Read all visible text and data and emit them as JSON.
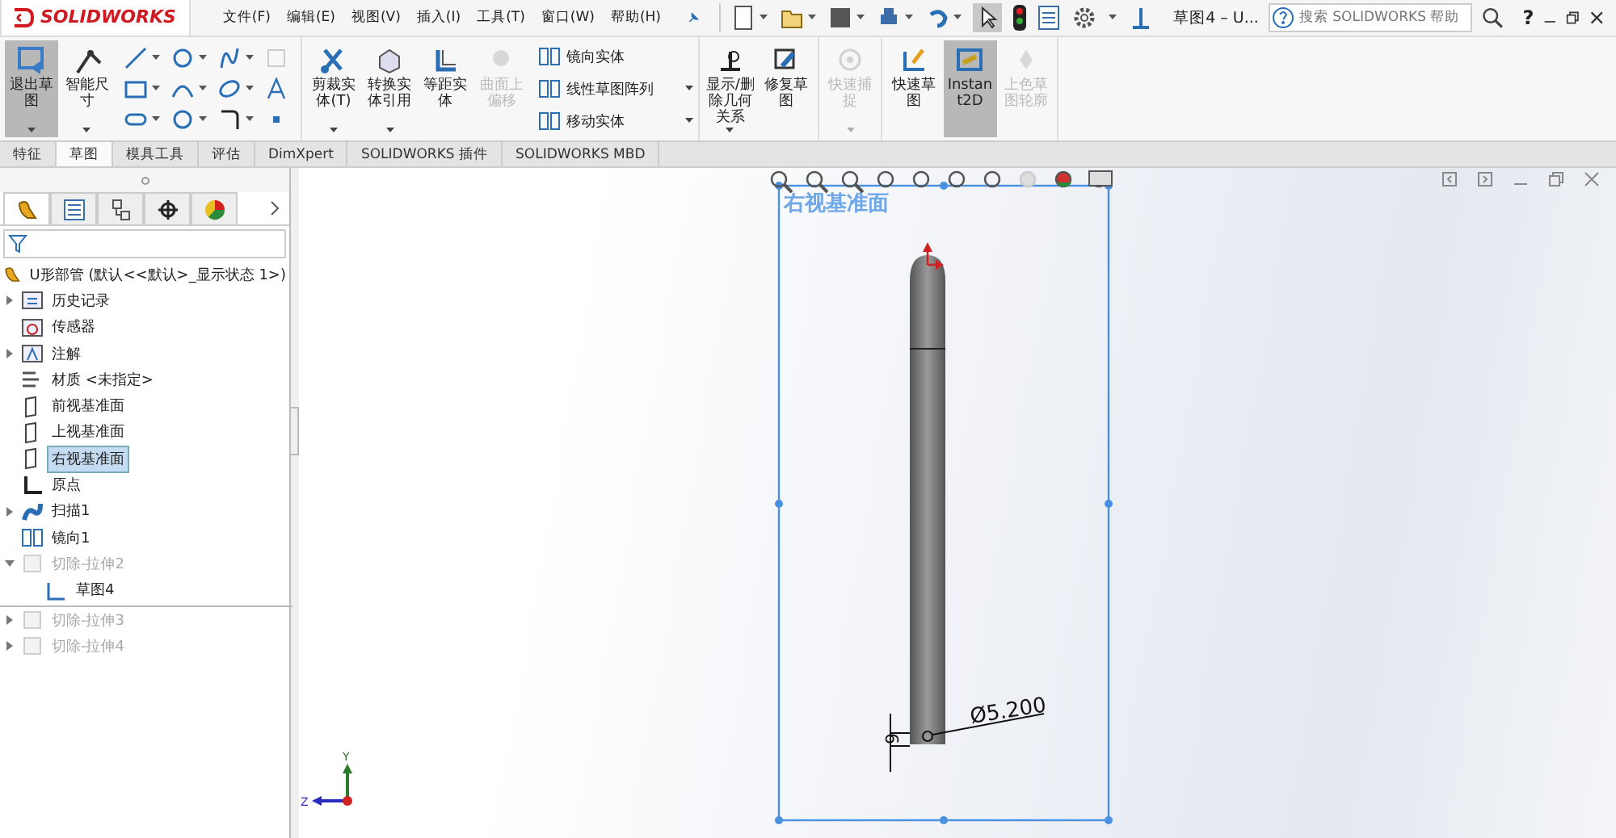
{
  "title_bar": {
    "logo": "SOLIDWORKS",
    "menu": [
      "文件(F)",
      "编辑(E)",
      "视图(V)",
      "插入(I)",
      "工具(T)",
      "窗口(W)",
      "帮助(H)"
    ],
    "document_title": "草图4 – U...",
    "search": {
      "placeholder": "搜索 SOLIDWORKS 帮助"
    },
    "help": "?"
  },
  "ribbon": {
    "groups": [
      {
        "buttons": [
          {
            "label": "退出草图",
            "selected": true,
            "disabled": false,
            "dropdown": true
          },
          {
            "label": "智能尺寸",
            "selected": false,
            "disabled": false,
            "dropdown": true
          }
        ],
        "sketch_tools": true
      },
      {
        "buttons": [
          {
            "label": "剪裁实体(T)",
            "selected": false,
            "disabled": false,
            "dropdown": true
          },
          {
            "label": "转换实体引用",
            "selected": false,
            "disabled": false,
            "dropdown": true
          },
          {
            "label": "等距实体",
            "selected": false,
            "disabled": false
          },
          {
            "label": "曲面上偏移",
            "selected": false,
            "disabled": true
          }
        ],
        "small": [
          {
            "label": "镜向实体"
          },
          {
            "label": "线性草图阵列",
            "dropdown": true
          },
          {
            "label": "移动实体",
            "dropdown": true
          }
        ]
      },
      {
        "buttons": [
          {
            "label": "显示/删除几何关系",
            "selected": false,
            "disabled": false,
            "dropdown": true
          },
          {
            "label": "修复草图",
            "selected": false,
            "disabled": false
          }
        ]
      },
      {
        "buttons": [
          {
            "label": "快速捕捉",
            "selected": false,
            "disabled": true,
            "dropdown": true
          }
        ]
      },
      {
        "buttons": [
          {
            "label": "快速草图",
            "selected": false,
            "disabled": false
          },
          {
            "label": "Instant2D",
            "selected": true,
            "disabled": false
          },
          {
            "label": "上色草图轮廓",
            "selected": false,
            "disabled": true
          }
        ]
      }
    ]
  },
  "command_tabs": [
    {
      "label": "特征",
      "selected": false
    },
    {
      "label": "草图",
      "selected": true
    },
    {
      "label": "模具工具",
      "selected": false
    },
    {
      "label": "评估",
      "selected": false
    },
    {
      "label": "DimXpert",
      "selected": false
    },
    {
      "label": "SOLIDWORKS 插件",
      "selected": false
    },
    {
      "label": "SOLIDWORKS MBD",
      "selected": false
    }
  ],
  "feature_tree": {
    "root": "U形部管  (默认<<默认>_显示状态 1>)",
    "items": [
      {
        "label": "历史记录",
        "expanded": false,
        "selected": false,
        "suppressed": false
      },
      {
        "label": "传感器",
        "selected": false,
        "suppressed": false
      },
      {
        "label": "注解",
        "expanded": false,
        "selected": false,
        "suppressed": false
      },
      {
        "label": "材质 <未指定>",
        "selected": false,
        "suppressed": false
      },
      {
        "label": "前视基准面",
        "selected": false,
        "suppressed": false
      },
      {
        "label": "上视基准面",
        "selected": false,
        "suppressed": false
      },
      {
        "label": "右视基准面",
        "selected": true,
        "suppressed": false
      },
      {
        "label": "原点",
        "selected": false,
        "suppressed": false
      },
      {
        "label": "扫描1",
        "expanded": false,
        "selected": false,
        "suppressed": false
      },
      {
        "label": "镜向1",
        "selected": false,
        "suppressed": false
      },
      {
        "label": "切除-拉伸2",
        "expanded": true,
        "selected": false,
        "suppressed": true,
        "children": [
          {
            "label": "草图4",
            "selected": false,
            "suppressed": false
          }
        ]
      },
      {
        "label": "切除-拉伸3",
        "expanded": false,
        "selected": false,
        "suppressed": true
      },
      {
        "label": "切除-拉伸4",
        "expanded": false,
        "selected": false,
        "suppressed": true
      }
    ]
  },
  "viewport": {
    "plane_label": "右视基准面",
    "diameter_dimension": "Ø5.200",
    "length_dimension": "6",
    "axes": [
      "Y",
      "Z"
    ]
  }
}
